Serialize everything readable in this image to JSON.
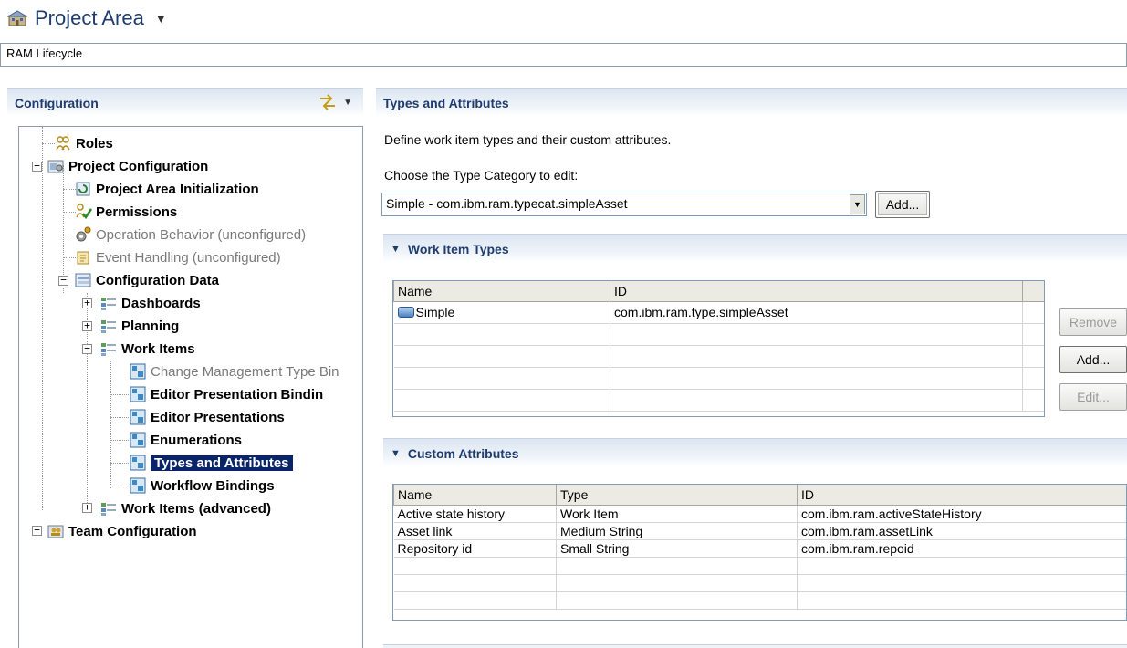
{
  "header": {
    "title": "Project Area"
  },
  "project_name": "RAM Lifecycle",
  "configuration": {
    "title": "Configuration",
    "tree": [
      {
        "label": "Roles",
        "bold": true
      },
      {
        "label": "Project Configuration",
        "bold": true
      },
      {
        "label": "Project Area Initialization",
        "bold": true
      },
      {
        "label": "Permissions",
        "bold": true
      },
      {
        "label": "Operation Behavior (unconfigured)",
        "bold": false
      },
      {
        "label": "Event Handling (unconfigured)",
        "bold": false
      },
      {
        "label": "Configuration Data",
        "bold": true
      },
      {
        "label": "Dashboards",
        "bold": true
      },
      {
        "label": "Planning",
        "bold": true
      },
      {
        "label": "Work Items",
        "bold": true
      },
      {
        "label": "Change Management Type Bin",
        "bold": false
      },
      {
        "label": "Editor Presentation Bindin",
        "bold": true
      },
      {
        "label": "Editor Presentations",
        "bold": true
      },
      {
        "label": "Enumerations",
        "bold": true
      },
      {
        "label": "Types and Attributes",
        "bold": true,
        "selected": true
      },
      {
        "label": "Workflow Bindings",
        "bold": true
      },
      {
        "label": "Work Items (advanced)",
        "bold": true
      },
      {
        "label": "Team Configuration",
        "bold": true
      }
    ]
  },
  "types_attributes": {
    "title": "Types and Attributes",
    "description": "Define work item types and their custom attributes.",
    "choose_label": "Choose the Type Category to edit:",
    "type_category_value": "Simple - com.ibm.ram.typecat.simpleAsset",
    "add_label": "Add..."
  },
  "work_item_types": {
    "title": "Work Item Types",
    "columns": [
      "Name",
      "ID"
    ],
    "rows": [
      {
        "name": "Simple",
        "id": "com.ibm.ram.type.simpleAsset"
      }
    ],
    "remove_label": "Remove",
    "add_label": "Add...",
    "edit_label": "Edit..."
  },
  "custom_attributes": {
    "title": "Custom Attributes",
    "columns": [
      "Name",
      "Type",
      "ID"
    ],
    "rows": [
      {
        "name": "Active state history",
        "type": "Work Item",
        "id": "com.ibm.ram.activeStateHistory"
      },
      {
        "name": "Asset link",
        "type": "Medium String",
        "id": "com.ibm.ram.assetLink"
      },
      {
        "name": "Repository id",
        "type": "Small String",
        "id": "com.ibm.ram.repoid"
      }
    ]
  }
}
